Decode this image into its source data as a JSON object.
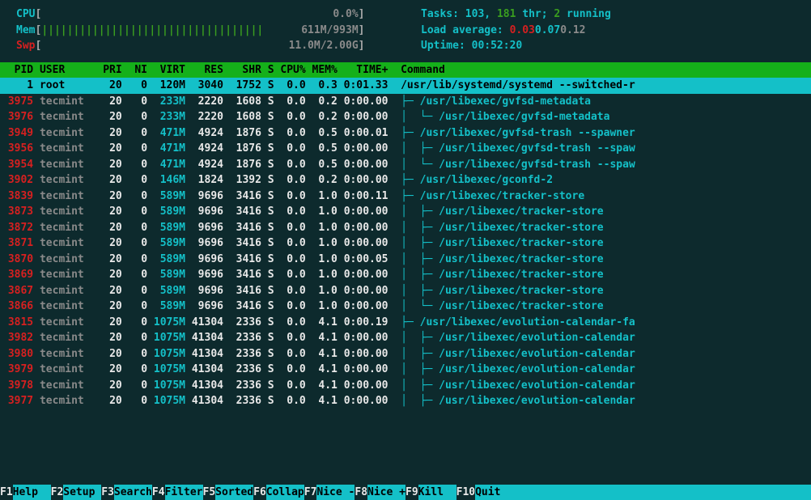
{
  "meters": {
    "cpu": {
      "label": "CPU",
      "bar": "",
      "value": "0.0%"
    },
    "mem": {
      "label": "Mem",
      "bar": "|||||||||||||||||||||||||||||||||||",
      "used": "611M",
      "total": "993M"
    },
    "swp": {
      "label": "Swp",
      "bar": "",
      "value": "11.0M/2.00G"
    }
  },
  "stats": {
    "tasks_label": "Tasks: ",
    "tasks": "103",
    "tasks_sep": ", ",
    "threads": "181",
    "threads_suffix": " thr; ",
    "running": "2",
    "running_suffix": " running",
    "load_label": "Load average: ",
    "load1": "0.03",
    "load5": "0.07",
    "load15": "0.12",
    "uptime_label": "Uptime: ",
    "uptime": "00:52:20"
  },
  "columns": "  PID USER      PRI  NI  VIRT   RES   SHR S CPU% MEM%   TIME+  Command",
  "selected": {
    "pid": "1",
    "user": "root",
    "pri": "20",
    "ni": "0",
    "virt": "120M",
    "res": "3040",
    "shr": "1752",
    "s": "S",
    "cpu": "0.0",
    "mem": "0.3",
    "time": "0:01.33",
    "cmd": "/usr/lib/systemd/systemd --switched-r"
  },
  "rows": [
    {
      "pid": "3975",
      "user": "tecmint",
      "pri": "20",
      "ni": "0",
      "virt": "233M",
      "res": "2220",
      "shr": "1608",
      "s": "S",
      "cpu": "0.0",
      "mem": "0.2",
      "time": "0:00.00",
      "tree": "├─ ",
      "cmd": "/usr/libexec/gvfsd-metadata"
    },
    {
      "pid": "3976",
      "user": "tecmint",
      "pri": "20",
      "ni": "0",
      "virt": "233M",
      "res": "2220",
      "shr": "1608",
      "s": "S",
      "cpu": "0.0",
      "mem": "0.2",
      "time": "0:00.00",
      "tree": "│  └─ ",
      "cmd": "/usr/libexec/gvfsd-metadata"
    },
    {
      "pid": "3949",
      "user": "tecmint",
      "pri": "20",
      "ni": "0",
      "virt": "471M",
      "res": "4924",
      "shr": "1876",
      "s": "S",
      "cpu": "0.0",
      "mem": "0.5",
      "time": "0:00.01",
      "tree": "├─ ",
      "cmd": "/usr/libexec/gvfsd-trash --spawner"
    },
    {
      "pid": "3956",
      "user": "tecmint",
      "pri": "20",
      "ni": "0",
      "virt": "471M",
      "res": "4924",
      "shr": "1876",
      "s": "S",
      "cpu": "0.0",
      "mem": "0.5",
      "time": "0:00.00",
      "tree": "│  ├─ ",
      "cmd": "/usr/libexec/gvfsd-trash --spaw"
    },
    {
      "pid": "3954",
      "user": "tecmint",
      "pri": "20",
      "ni": "0",
      "virt": "471M",
      "res": "4924",
      "shr": "1876",
      "s": "S",
      "cpu": "0.0",
      "mem": "0.5",
      "time": "0:00.00",
      "tree": "│  └─ ",
      "cmd": "/usr/libexec/gvfsd-trash --spaw"
    },
    {
      "pid": "3902",
      "user": "tecmint",
      "pri": "20",
      "ni": "0",
      "virt": "146M",
      "res": "1824",
      "shr": "1392",
      "s": "S",
      "cpu": "0.0",
      "mem": "0.2",
      "time": "0:00.00",
      "tree": "├─ ",
      "cmd": "/usr/libexec/gconfd-2"
    },
    {
      "pid": "3839",
      "user": "tecmint",
      "pri": "20",
      "ni": "0",
      "virt": "589M",
      "res": "9696",
      "shr": "3416",
      "s": "S",
      "cpu": "0.0",
      "mem": "1.0",
      "time": "0:00.11",
      "tree": "├─ ",
      "cmd": "/usr/libexec/tracker-store"
    },
    {
      "pid": "3873",
      "user": "tecmint",
      "pri": "20",
      "ni": "0",
      "virt": "589M",
      "res": "9696",
      "shr": "3416",
      "s": "S",
      "cpu": "0.0",
      "mem": "1.0",
      "time": "0:00.00",
      "tree": "│  ├─ ",
      "cmd": "/usr/libexec/tracker-store"
    },
    {
      "pid": "3872",
      "user": "tecmint",
      "pri": "20",
      "ni": "0",
      "virt": "589M",
      "res": "9696",
      "shr": "3416",
      "s": "S",
      "cpu": "0.0",
      "mem": "1.0",
      "time": "0:00.00",
      "tree": "│  ├─ ",
      "cmd": "/usr/libexec/tracker-store"
    },
    {
      "pid": "3871",
      "user": "tecmint",
      "pri": "20",
      "ni": "0",
      "virt": "589M",
      "res": "9696",
      "shr": "3416",
      "s": "S",
      "cpu": "0.0",
      "mem": "1.0",
      "time": "0:00.00",
      "tree": "│  ├─ ",
      "cmd": "/usr/libexec/tracker-store"
    },
    {
      "pid": "3870",
      "user": "tecmint",
      "pri": "20",
      "ni": "0",
      "virt": "589M",
      "res": "9696",
      "shr": "3416",
      "s": "S",
      "cpu": "0.0",
      "mem": "1.0",
      "time": "0:00.05",
      "tree": "│  ├─ ",
      "cmd": "/usr/libexec/tracker-store"
    },
    {
      "pid": "3869",
      "user": "tecmint",
      "pri": "20",
      "ni": "0",
      "virt": "589M",
      "res": "9696",
      "shr": "3416",
      "s": "S",
      "cpu": "0.0",
      "mem": "1.0",
      "time": "0:00.00",
      "tree": "│  ├─ ",
      "cmd": "/usr/libexec/tracker-store"
    },
    {
      "pid": "3867",
      "user": "tecmint",
      "pri": "20",
      "ni": "0",
      "virt": "589M",
      "res": "9696",
      "shr": "3416",
      "s": "S",
      "cpu": "0.0",
      "mem": "1.0",
      "time": "0:00.00",
      "tree": "│  ├─ ",
      "cmd": "/usr/libexec/tracker-store"
    },
    {
      "pid": "3866",
      "user": "tecmint",
      "pri": "20",
      "ni": "0",
      "virt": "589M",
      "res": "9696",
      "shr": "3416",
      "s": "S",
      "cpu": "0.0",
      "mem": "1.0",
      "time": "0:00.00",
      "tree": "│  └─ ",
      "cmd": "/usr/libexec/tracker-store"
    },
    {
      "pid": "3815",
      "user": "tecmint",
      "pri": "20",
      "ni": "0",
      "virt": "1075M",
      "res": "41304",
      "shr": "2336",
      "s": "S",
      "cpu": "0.0",
      "mem": "4.1",
      "time": "0:00.19",
      "tree": "├─ ",
      "cmd": "/usr/libexec/evolution-calendar-fa"
    },
    {
      "pid": "3982",
      "user": "tecmint",
      "pri": "20",
      "ni": "0",
      "virt": "1075M",
      "res": "41304",
      "shr": "2336",
      "s": "S",
      "cpu": "0.0",
      "mem": "4.1",
      "time": "0:00.00",
      "tree": "│  ├─ ",
      "cmd": "/usr/libexec/evolution-calendar"
    },
    {
      "pid": "3980",
      "user": "tecmint",
      "pri": "20",
      "ni": "0",
      "virt": "1075M",
      "res": "41304",
      "shr": "2336",
      "s": "S",
      "cpu": "0.0",
      "mem": "4.1",
      "time": "0:00.00",
      "tree": "│  ├─ ",
      "cmd": "/usr/libexec/evolution-calendar"
    },
    {
      "pid": "3979",
      "user": "tecmint",
      "pri": "20",
      "ni": "0",
      "virt": "1075M",
      "res": "41304",
      "shr": "2336",
      "s": "S",
      "cpu": "0.0",
      "mem": "4.1",
      "time": "0:00.00",
      "tree": "│  ├─ ",
      "cmd": "/usr/libexec/evolution-calendar"
    },
    {
      "pid": "3978",
      "user": "tecmint",
      "pri": "20",
      "ni": "0",
      "virt": "1075M",
      "res": "41304",
      "shr": "2336",
      "s": "S",
      "cpu": "0.0",
      "mem": "4.1",
      "time": "0:00.00",
      "tree": "│  ├─ ",
      "cmd": "/usr/libexec/evolution-calendar"
    },
    {
      "pid": "3977",
      "user": "tecmint",
      "pri": "20",
      "ni": "0",
      "virt": "1075M",
      "res": "41304",
      "shr": "2336",
      "s": "S",
      "cpu": "0.0",
      "mem": "4.1",
      "time": "0:00.00",
      "tree": "│  ├─ ",
      "cmd": "/usr/libexec/evolution-calendar"
    }
  ],
  "fnbar": [
    {
      "key": "F1",
      "label": "Help  "
    },
    {
      "key": "F2",
      "label": "Setup "
    },
    {
      "key": "F3",
      "label": "Search"
    },
    {
      "key": "F4",
      "label": "Filter"
    },
    {
      "key": "F5",
      "label": "Sorted"
    },
    {
      "key": "F6",
      "label": "Collap"
    },
    {
      "key": "F7",
      "label": "Nice -"
    },
    {
      "key": "F8",
      "label": "Nice +"
    },
    {
      "key": "F9",
      "label": "Kill  "
    },
    {
      "key": "F10",
      "label": "Quit  "
    }
  ]
}
